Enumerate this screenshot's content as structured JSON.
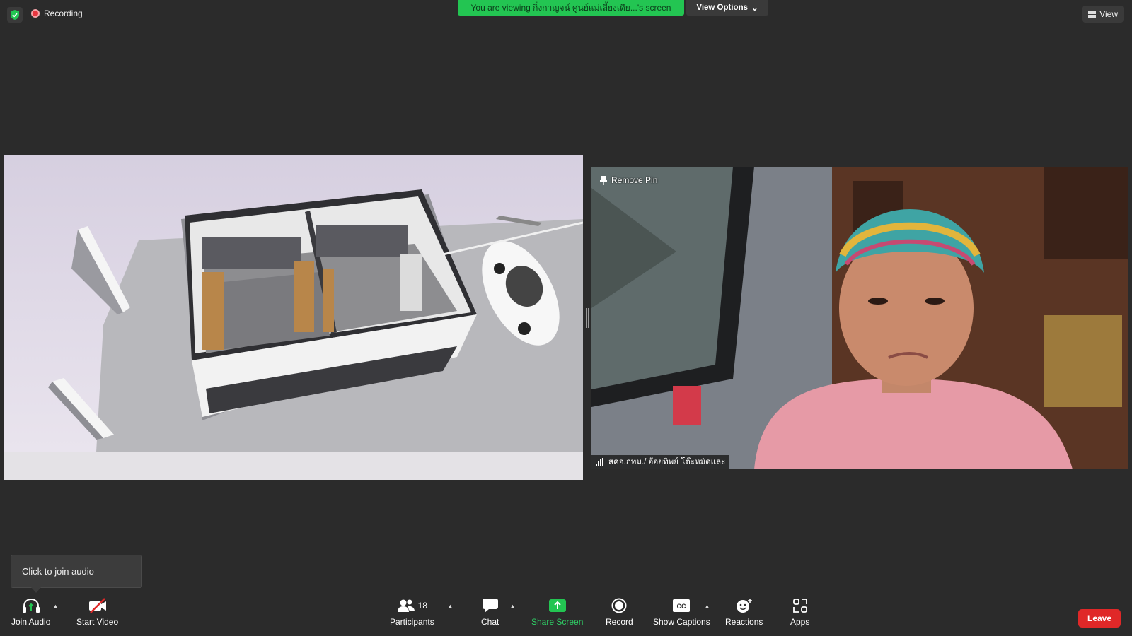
{
  "top_bar": {
    "recording_label": "Recording",
    "viewing_banner": "You are viewing กิ่งกาญจน์ ศูนย์แม่เลี้ยงเดีย...'s screen",
    "view_options_label": "View Options",
    "view_label": "View"
  },
  "video_tile": {
    "remove_pin_label": "Remove Pin",
    "participant_name": "สคอ.กทม./ อ้อยทิพย์ โต๊ะหมัดและ"
  },
  "tooltip": {
    "text": "Click to join audio"
  },
  "toolbar": {
    "join_audio": "Join Audio",
    "start_video": "Start Video",
    "participants": "Participants",
    "participants_count": "18",
    "chat": "Chat",
    "share_screen": "Share Screen",
    "record": "Record",
    "show_captions": "Show Captions",
    "reactions": "Reactions",
    "apps": "Apps",
    "leave": "Leave"
  },
  "colors": {
    "background": "#2b2b2b",
    "share_green": "#23c552",
    "leave_red": "#e02828",
    "recording_red": "#e8353f"
  }
}
